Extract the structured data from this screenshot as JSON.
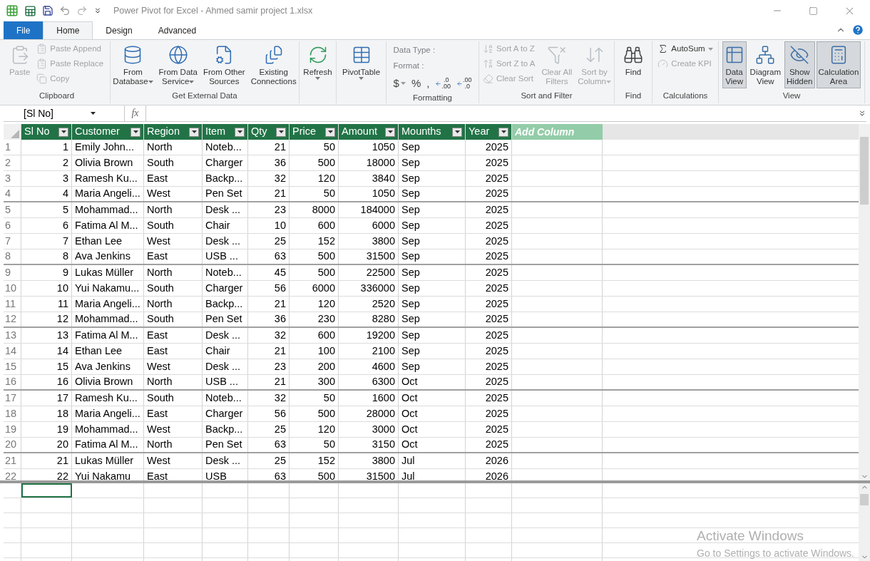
{
  "window": {
    "title": "Power Pivot for Excel - Ahmed samir project 1.xlsx"
  },
  "ribbon": {
    "file_button": "File",
    "tabs": [
      {
        "label": "Home",
        "selected": true
      },
      {
        "label": "Design",
        "selected": false
      },
      {
        "label": "Advanced",
        "selected": false
      }
    ],
    "groups": [
      {
        "label": "Clipboard",
        "kind": "buttons",
        "items": [
          {
            "label": "Paste",
            "kind": "large",
            "disabled": true
          },
          {
            "label": "Paste Append",
            "kind": "small",
            "disabled": true
          },
          {
            "label": "Paste Replace",
            "kind": "small",
            "disabled": true
          },
          {
            "label": "Copy",
            "kind": "small",
            "disabled": true
          }
        ]
      },
      {
        "label": "Get External Data",
        "kind": "buttons",
        "items": [
          {
            "label": "From\nDatabase",
            "kind": "large",
            "disabled": false,
            "dropdown": true
          },
          {
            "label": "From Data\nService",
            "kind": "large",
            "disabled": false,
            "dropdown": true
          },
          {
            "label": "From Other\nSources",
            "kind": "large",
            "disabled": false,
            "dropdown": false
          },
          {
            "label": "Existing\nConnections",
            "kind": "large",
            "disabled": false,
            "dropdown": false
          }
        ]
      },
      {
        "kind": "buttons",
        "items": [
          {
            "label": "Refresh",
            "kind": "split",
            "disabled": false
          }
        ]
      },
      {
        "kind": "buttons",
        "items": [
          {
            "label": "PivotTable",
            "kind": "split",
            "disabled": false
          }
        ]
      },
      {
        "label": "Formatting",
        "kind": "format",
        "data_type": "Data Type :",
        "format": "Format :",
        "symbols": [
          {
            "label": "$",
            "dropdown": true
          },
          {
            "label": "%",
            "dropdown": false
          },
          {
            "label": ",",
            "dropdown": false
          }
        ],
        "decimals": [
          {
            "top": ".0",
            "bottom": ".00"
          },
          {
            "top": ".00",
            "bottom": ".0"
          }
        ]
      },
      {
        "label": "Sort and Filter",
        "kind": "buttons",
        "items": [
          {
            "label": "Sort A to Z",
            "kind": "small",
            "disabled": true
          },
          {
            "label": "Sort Z to A",
            "kind": "small",
            "disabled": true
          },
          {
            "label": "Clear Sort",
            "kind": "small",
            "disabled": true
          },
          {
            "label": "Clear All\nFilters",
            "kind": "large",
            "disabled": true,
            "dropdown": false
          },
          {
            "label": "Sort by\nColumn",
            "kind": "large",
            "disabled": true,
            "dropdown": true
          }
        ]
      },
      {
        "label": "Find",
        "kind": "buttons",
        "items": [
          {
            "label": "Find",
            "kind": "large",
            "disabled": false,
            "dropdown": false
          }
        ]
      },
      {
        "label": "Calculations",
        "kind": "buttons",
        "items": [
          {
            "label": "AutoSum",
            "kind": "small",
            "disabled": false,
            "dropdown": true
          },
          {
            "label": "Create KPI",
            "kind": "small",
            "disabled": true,
            "dropdown": false
          }
        ]
      },
      {
        "label": "View",
        "kind": "buttons",
        "items": [
          {
            "label": "Data\nView",
            "kind": "large",
            "disabled": false,
            "selected": true
          },
          {
            "label": "Diagram\nView",
            "kind": "large",
            "disabled": false,
            "selected": false
          },
          {
            "label": "Show\nHidden",
            "kind": "large",
            "disabled": false,
            "selected": true
          },
          {
            "label": "Calculation\nArea",
            "kind": "large",
            "disabled": false,
            "selected": true
          }
        ]
      }
    ]
  },
  "formula_bar": {
    "name_box": "[Sl No]",
    "fx": "fx"
  },
  "table": {
    "columns": [
      {
        "label": "Sl No",
        "kind": "number"
      },
      {
        "label": "Customer",
        "kind": "text"
      },
      {
        "label": "Region",
        "kind": "text"
      },
      {
        "label": "Item",
        "kind": "text"
      },
      {
        "label": "Qty",
        "kind": "number"
      },
      {
        "label": "Price",
        "kind": "number"
      },
      {
        "label": "Amount",
        "kind": "number"
      },
      {
        "label": "Mounths",
        "kind": "text"
      },
      {
        "label": "Year",
        "kind": "number"
      },
      {
        "label": "Add Column",
        "kind": "add"
      }
    ],
    "rows": [
      {
        "n": "1",
        "cells": [
          "1",
          "Emily John...",
          "North",
          "Noteb...",
          "21",
          "50",
          "1050",
          "Sep",
          "2025"
        ]
      },
      {
        "n": "2",
        "cells": [
          "2",
          "Olivia Brown",
          "South",
          "Charger",
          "36",
          "500",
          "18000",
          "Sep",
          "2025"
        ]
      },
      {
        "n": "3",
        "cells": [
          "3",
          "Ramesh Ku...",
          "East",
          "Backp...",
          "32",
          "120",
          "3840",
          "Sep",
          "2025"
        ]
      },
      {
        "n": "4",
        "cells": [
          "4",
          "Maria Angeli...",
          "West",
          "Pen Set",
          "21",
          "50",
          "1050",
          "Sep",
          "2025"
        ]
      },
      {
        "n": "5",
        "cells": [
          "5",
          "Mohammad...",
          "North",
          "Desk ...",
          "23",
          "8000",
          "184000",
          "Sep",
          "2025"
        ]
      },
      {
        "n": "6",
        "cells": [
          "6",
          "Fatima Al M...",
          "South",
          "Chair",
          "10",
          "600",
          "6000",
          "Sep",
          "2025"
        ]
      },
      {
        "n": "7",
        "cells": [
          "7",
          "Ethan Lee",
          "West",
          "Desk ...",
          "25",
          "152",
          "3800",
          "Sep",
          "2025"
        ]
      },
      {
        "n": "8",
        "cells": [
          "8",
          "Ava Jenkins",
          "East",
          "USB ...",
          "63",
          "500",
          "31500",
          "Sep",
          "2025"
        ]
      },
      {
        "n": "9",
        "cells": [
          "9",
          "Lukas Müller",
          "North",
          "Noteb...",
          "45",
          "500",
          "22500",
          "Sep",
          "2025"
        ]
      },
      {
        "n": "10",
        "cells": [
          "10",
          "Yui Nakamu...",
          "South",
          "Charger",
          "56",
          "6000",
          "336000",
          "Sep",
          "2025"
        ]
      },
      {
        "n": "11",
        "cells": [
          "11",
          "Maria Angeli...",
          "North",
          "Backp...",
          "21",
          "120",
          "2520",
          "Sep",
          "2025"
        ]
      },
      {
        "n": "12",
        "cells": [
          "12",
          "Mohammad...",
          "South",
          "Pen Set",
          "36",
          "230",
          "8280",
          "Sep",
          "2025"
        ]
      },
      {
        "n": "13",
        "cells": [
          "13",
          "Fatima Al M...",
          "East",
          "Desk ...",
          "32",
          "600",
          "19200",
          "Sep",
          "2025"
        ]
      },
      {
        "n": "14",
        "cells": [
          "14",
          "Ethan Lee",
          "East",
          "Chair",
          "21",
          "100",
          "2100",
          "Sep",
          "2025"
        ]
      },
      {
        "n": "15",
        "cells": [
          "15",
          "Ava Jenkins",
          "West",
          "Desk ...",
          "23",
          "200",
          "4600",
          "Sep",
          "2025"
        ]
      },
      {
        "n": "16",
        "cells": [
          "16",
          "Olivia Brown",
          "North",
          "USB ...",
          "21",
          "300",
          "6300",
          "Oct",
          "2025"
        ]
      },
      {
        "n": "17",
        "cells": [
          "17",
          "Ramesh Ku...",
          "South",
          "Noteb...",
          "32",
          "50",
          "1600",
          "Oct",
          "2025"
        ]
      },
      {
        "n": "18",
        "cells": [
          "18",
          "Maria Angeli...",
          "East",
          "Charger",
          "56",
          "500",
          "28000",
          "Oct",
          "2025"
        ]
      },
      {
        "n": "19",
        "cells": [
          "19",
          "Mohammad...",
          "West",
          "Backp...",
          "25",
          "120",
          "3000",
          "Oct",
          "2025"
        ]
      },
      {
        "n": "20",
        "cells": [
          "20",
          "Fatima Al M...",
          "North",
          "Pen Set",
          "63",
          "50",
          "3150",
          "Oct",
          "2025"
        ]
      },
      {
        "n": "21",
        "cells": [
          "21",
          "Lukas Müller",
          "West",
          "Desk ...",
          "25",
          "152",
          "3800",
          "Jul",
          "2026"
        ]
      },
      {
        "n": "22",
        "cells": [
          "22",
          "Yui Nakamu",
          "East",
          "USB",
          "63",
          "500",
          "31500",
          "Jul",
          "2026"
        ]
      }
    ]
  },
  "calc_area": {
    "first_cell_selected": true
  },
  "os_notice": {
    "title": "Activate Windows",
    "text": "Go to Settings to activate Windows."
  }
}
